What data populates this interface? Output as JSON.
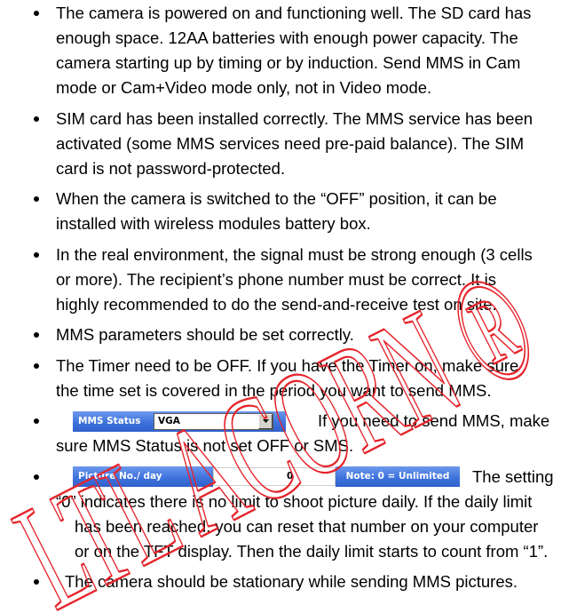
{
  "items": [
    {
      "lines": [
        "The camera is powered on and functioning well. The SD card has",
        "enough space. 12AA batteries with enough power capacity. The",
        "camera starting up by timing or by induction. Send MMS in Cam",
        "mode or Cam+Video mode only, not in Video mode."
      ]
    },
    {
      "lines": [
        "SIM card has been installed correctly. The MMS service has been",
        "activated (some MMS services need pre-paid balance). The SIM",
        "card is not password-protected."
      ]
    },
    {
      "lines": [
        "When the camera is switched to the “OFF” position, it can be",
        "installed with wireless modules battery box."
      ]
    },
    {
      "lines": [
        "In the real environment, the signal must be strong enough (3 cells",
        "or more). The recipient’s phone number must be correct. It is",
        "highly recommended to do the send-and-receive test on site."
      ]
    },
    {
      "lines": [
        "MMS parameters should be set correctly."
      ]
    },
    {
      "lines": [
        "The Timer need to be OFF. If you have the Timer on, make sure",
        "the time set is covered in the period you want to send MMS."
      ]
    },
    {
      "lines": [
        "If you need to send MMS, make",
        "sure MMS Status is not set OFF or SMS."
      ]
    },
    {
      "lines": [
        "The setting",
        "“0” indicates there is no limit to shoot picture daily. If the daily limit",
        "has been reached, you can reset that number on your computer",
        "or on the TFT display. Then the daily limit starts to count from “1”."
      ]
    },
    {
      "lines": [
        "The camera should be stationary while sending MMS pictures."
      ]
    }
  ],
  "mms_status_widget": {
    "label": "MMS Status",
    "selected": "VGA",
    "icon": "chevron-down-icon"
  },
  "picture_limit_widget": {
    "label": "Picture No./ day",
    "value": "0",
    "note": "Note: 0 = Unlimited"
  },
  "watermark": {
    "text": "LTL ACORN ®",
    "color": "#e5252c"
  },
  "colors": {
    "widget_blue": "#3f72dc",
    "text": "#000000"
  }
}
